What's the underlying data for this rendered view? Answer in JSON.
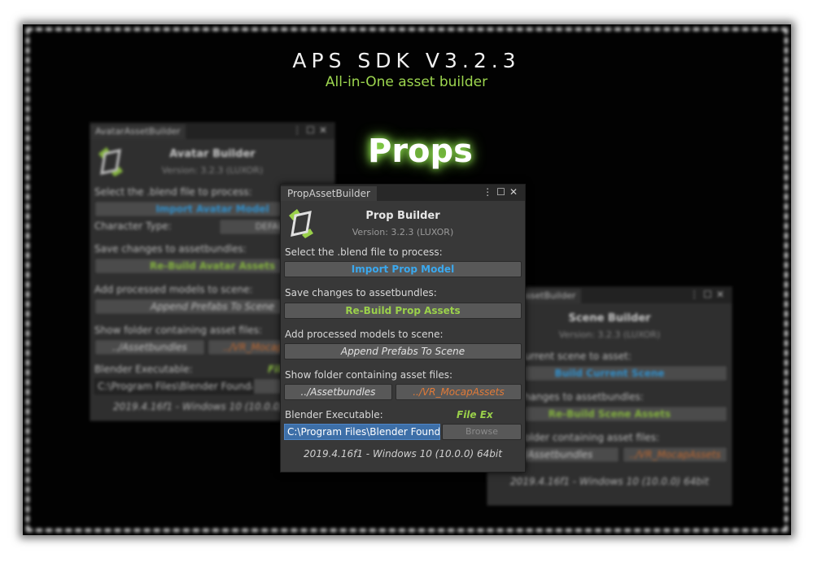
{
  "header": {
    "title": "APS SDK V3.2.3",
    "subtitle": "All-in-One asset builder",
    "feature": "Props"
  },
  "avatar_window": {
    "tab": "AvatarAssetBuilder",
    "title": "Avatar Builder",
    "version": "Version: 3.2.3 (LUXOR)",
    "select_label": "Select the .blend file to process:",
    "import_label": "Import Avatar Model",
    "character_type_label": "Character Type:",
    "character_type_value": "DEFAULT",
    "save_label": "Save changes to assetbundles:",
    "rebuild_label": "Re-Build Avatar Assets",
    "add_label": "Add processed models to scene:",
    "append_label": "Append Prefabs To Scene",
    "folder_label": "Show folder containing asset files:",
    "assetbundles_label": "../Assetbundles",
    "mocap_label": "../VR_MocapAssets",
    "blender_label": "Blender Executable:",
    "file_ex_label": "File Ex",
    "blender_path": "C:\\Program Files\\Blender Foundation",
    "footer": "2019.4.16f1 - Windows 10  (10.0.0) 64bit"
  },
  "prop_window": {
    "tab": "PropAssetBuilder",
    "title": "Prop Builder",
    "version": "Version: 3.2.3 (LUXOR)",
    "select_label": "Select the .blend file to process:",
    "import_label": "Import Prop Model",
    "save_label": "Save changes to assetbundles:",
    "rebuild_label": "Re-Build Prop Assets",
    "add_label": "Add processed models to scene:",
    "append_label": "Append Prefabs To Scene",
    "folder_label": "Show folder containing asset files:",
    "assetbundles_label": "../Assetbundles",
    "mocap_label": "../VR_MocapAssets",
    "blender_label": "Blender Executable:",
    "file_ex_label": "File Ex",
    "blender_path": "C:\\Program Files\\Blender Foundation",
    "browse_label": "Browse",
    "footer": "2019.4.16f1 - Windows 10  (10.0.0) 64bit"
  },
  "scene_window": {
    "tab": "SceneAssetBuilder",
    "title": "Scene Builder",
    "version": "Version: 3.2.3 (LUXOR)",
    "build_label": "Build current scene to asset:",
    "build_button": "Build Current Scene",
    "save_label": "Save changes to assetbundles:",
    "rebuild_label": "Re-Build Scene Assets",
    "folder_label": "Show folder containing asset files:",
    "assetbundles_label": "../Assetbundles",
    "mocap_label": "../VR_MocapAssets",
    "footer": "2019.4.16f1 - Windows 10  (10.0.0) 64bit"
  },
  "tab_icons": {
    "menu": "⋮",
    "maximize": "☐",
    "close": "✕"
  },
  "colors": {
    "accent_blue": "#3aa8ee",
    "accent_green": "#9ad04a",
    "accent_orange": "#e07a38",
    "glow": "#a6ff5a"
  }
}
